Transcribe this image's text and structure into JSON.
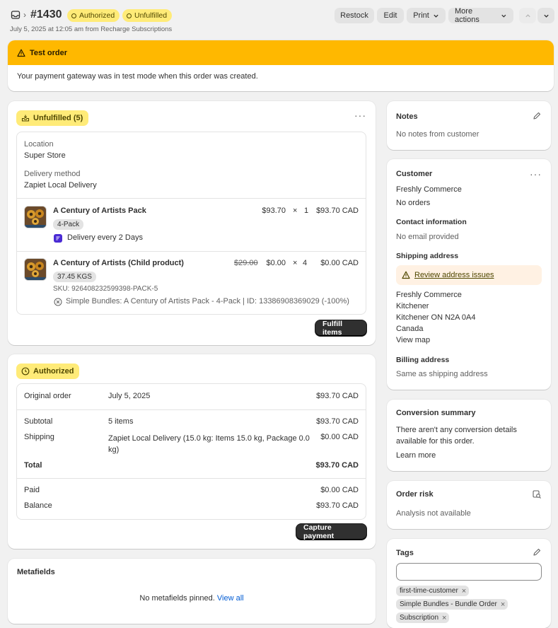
{
  "header": {
    "order_number": "#1430",
    "badges": [
      "Authorized",
      "Unfulfilled"
    ],
    "subtitle": "July 5, 2025 at 12:05 am from Recharge Subscriptions",
    "actions": {
      "restock": "Restock",
      "edit": "Edit",
      "print": "Print",
      "more_actions": "More actions"
    }
  },
  "test_banner": {
    "title": "Test order",
    "message": "Your payment gateway was in test mode when this order was created."
  },
  "fulfillment": {
    "status": "Unfulfilled (5)",
    "location_label": "Location",
    "location_value": "Super Store",
    "delivery_label": "Delivery method",
    "delivery_value": "Zapiet Local Delivery",
    "items": [
      {
        "title": "A Century of Artists Pack",
        "variant": "4-Pack",
        "subscription": "Delivery every 2 Days",
        "original_price": "",
        "price": "$93.70",
        "times": "×",
        "qty": "1",
        "total": "$93.70 CAD"
      },
      {
        "title": "A Century of Artists (Child product)",
        "variant": "37.45 KGS",
        "sku": "SKU: 926408232599398-PACK-5",
        "bundle": "Simple Bundles: A Century of Artists Pack - 4-Pack | ID: 13386908369029 (-100%)",
        "original_price": "$29.00",
        "price": "$0.00",
        "times": "×",
        "qty": "4",
        "total": "$0.00 CAD"
      }
    ],
    "fulfill_button": "Fulfill items"
  },
  "payment": {
    "status": "Authorized",
    "original_order_label": "Original order",
    "original_order_date": "July 5, 2025",
    "original_order_amount": "$93.70 CAD",
    "subtotal_label": "Subtotal",
    "subtotal_items": "5 items",
    "subtotal_amount": "$93.70 CAD",
    "shipping_label": "Shipping",
    "shipping_desc": "Zapiet Local Delivery (15.0 kg: Items 15.0 kg, Package 0.0 kg)",
    "shipping_amount": "$0.00 CAD",
    "total_label": "Total",
    "total_amount": "$93.70 CAD",
    "paid_label": "Paid",
    "paid_amount": "$0.00 CAD",
    "balance_label": "Balance",
    "balance_amount": "$93.70 CAD",
    "capture_button": "Capture payment"
  },
  "metafields": {
    "title": "Metafields",
    "empty_text": "No metafields pinned.",
    "view_all": "View all"
  },
  "notes": {
    "title": "Notes",
    "text": "No notes from customer"
  },
  "customer": {
    "title": "Customer",
    "name": "Freshly Commerce",
    "orders": "No orders",
    "contact_title": "Contact information",
    "contact_text": "No email provided",
    "shipping_title": "Shipping address",
    "address_warning": "Review address issues",
    "address_lines": [
      "Freshly Commerce",
      "Kitchener",
      "Kitchener ON N2A 0A4",
      "Canada"
    ],
    "view_map": "View map",
    "billing_title": "Billing address",
    "billing_text": "Same as shipping address"
  },
  "conversion": {
    "title": "Conversion summary",
    "text": "There aren't any conversion details available for this order.",
    "learn_more": "Learn more"
  },
  "risk": {
    "title": "Order risk",
    "text": "Analysis not available"
  },
  "tags": {
    "title": "Tags",
    "input_value": "",
    "items": [
      "first-time-customer",
      "Simple Bundles - Bundle Order",
      "Subscription"
    ]
  }
}
